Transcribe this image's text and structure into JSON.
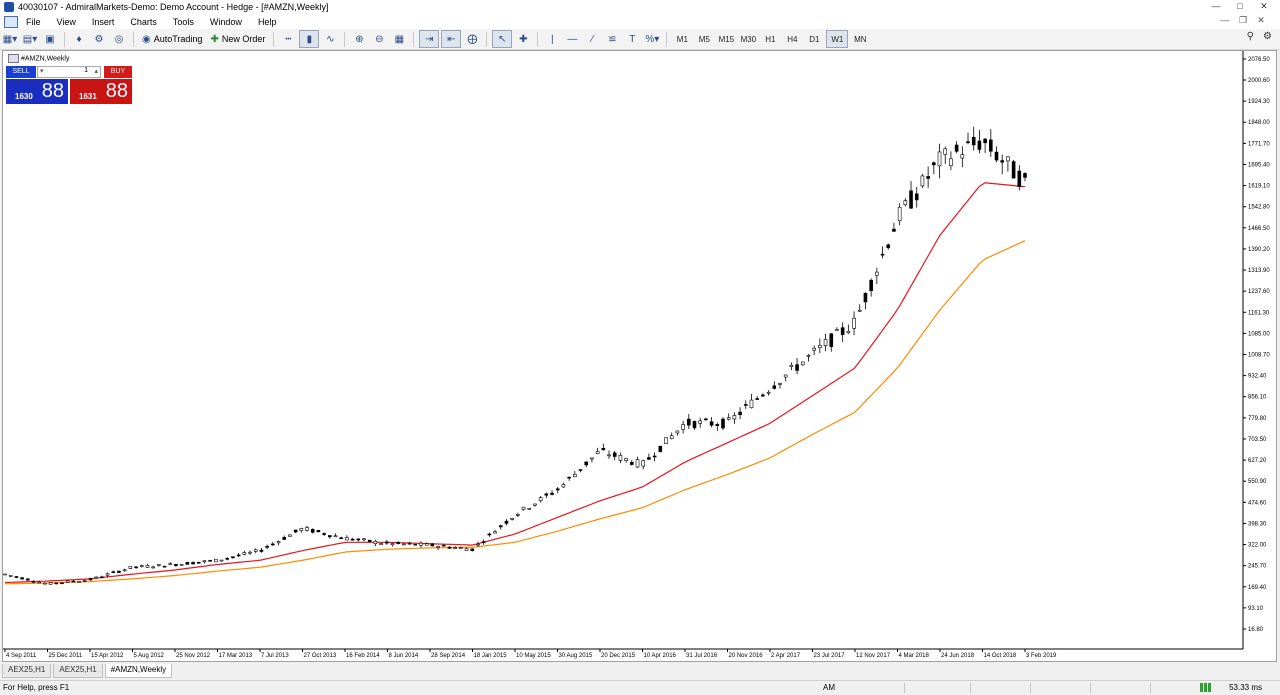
{
  "window": {
    "title": "40030107 - AdmiralMarkets-Demo: Demo Account - Hedge - [#AMZN,Weekly]"
  },
  "menu": [
    "File",
    "View",
    "Insert",
    "Charts",
    "Tools",
    "Window",
    "Help"
  ],
  "toolbar": {
    "autotrading": "AutoTrading",
    "new_order": "New Order",
    "periods": [
      "M1",
      "M5",
      "M15",
      "M30",
      "H1",
      "H4",
      "D1",
      "W1",
      "MN"
    ],
    "active_period": "W1"
  },
  "chart_header": "#AMZN,Weekly",
  "one_click": {
    "sell": "SELL",
    "buy": "BUY",
    "lot": "1",
    "bid_small": "1630",
    "bid_big": "88",
    "ask_small": "1631",
    "ask_big": "88",
    "sell_color": "#1a2fc0",
    "buy_color": "#c91414"
  },
  "chart_data": {
    "type": "candlestick",
    "symbol": "#AMZN",
    "timeframe": "Weekly",
    "x_ticks": [
      "4 Sep 2011",
      "25 Dec 2011",
      "15 Apr 2012",
      "5 Aug 2012",
      "25 Nov 2012",
      "17 Mar 2013",
      "7 Jul 2013",
      "27 Oct 2013",
      "16 Feb 2014",
      "8 Jun 2014",
      "28 Sep 2014",
      "18 Jan 2015",
      "10 May 2015",
      "30 Aug 2015",
      "20 Dec 2015",
      "10 Apr 2016",
      "31 Jul 2016",
      "20 Nov 2016",
      "2 Apr 2017",
      "23 Jul 2017",
      "12 Nov 2017",
      "4 Mar 2018",
      "24 Jun 2018",
      "14 Oct 2018",
      "3 Feb 2019"
    ],
    "y_ticks": [
      "2076.50",
      "2000.60",
      "1924.30",
      "1848.00",
      "1771.70",
      "1695.40",
      "1619.10",
      "1542.80",
      "1466.50",
      "1390.20",
      "1313.90",
      "1237.60",
      "1161.30",
      "1085.00",
      "1008.70",
      "932.40",
      "856.10",
      "779.80",
      "703.50",
      "627.20",
      "550.90",
      "474.60",
      "398.30",
      "322.00",
      "245.70",
      "169.40",
      "93.10",
      "16.80"
    ],
    "ylim": [
      16.8,
      2076.5
    ],
    "series": [
      {
        "name": "candles",
        "points": [
          [
            "4 Sep 2011",
            215
          ],
          [
            "25 Dec 2011",
            180
          ],
          [
            "15 Apr 2012",
            195
          ],
          [
            "5 Aug 2012",
            240
          ],
          [
            "25 Nov 2012",
            250
          ],
          [
            "17 Mar 2013",
            265
          ],
          [
            "7 Jul 2013",
            300
          ],
          [
            "27 Oct 2013",
            380
          ],
          [
            "16 Feb 2014",
            345
          ],
          [
            "8 Jun 2014",
            325
          ],
          [
            "28 Sep 2014",
            320
          ],
          [
            "18 Jan 2015",
            305
          ],
          [
            "10 May 2015",
            430
          ],
          [
            "30 Aug 2015",
            520
          ],
          [
            "20 Dec 2015",
            660
          ],
          [
            "10 Apr 2016",
            610
          ],
          [
            "31 Jul 2016",
            760
          ],
          [
            "20 Nov 2016",
            760
          ],
          [
            "2 Apr 2017",
            890
          ],
          [
            "23 Jul 2017",
            1010
          ],
          [
            "12 Nov 2017",
            1125
          ],
          [
            "4 Mar 2018",
            1500
          ],
          [
            "24 Jun 2018",
            1710
          ],
          [
            "14 Oct 2018",
            1780
          ],
          [
            "3 Feb 2019",
            1630
          ]
        ]
      },
      {
        "name": "red_ma",
        "color": "#e8141c",
        "points": [
          [
            "4 Sep 2011",
            185
          ],
          [
            "25 Dec 2011",
            190
          ],
          [
            "15 Apr 2012",
            198
          ],
          [
            "5 Aug 2012",
            215
          ],
          [
            "25 Nov 2012",
            230
          ],
          [
            "17 Mar 2013",
            250
          ],
          [
            "7 Jul 2013",
            265
          ],
          [
            "27 Oct 2013",
            300
          ],
          [
            "16 Feb 2014",
            330
          ],
          [
            "8 Jun 2014",
            330
          ],
          [
            "28 Sep 2014",
            325
          ],
          [
            "18 Jan 2015",
            320
          ],
          [
            "10 May 2015",
            360
          ],
          [
            "30 Aug 2015",
            420
          ],
          [
            "20 Dec 2015",
            480
          ],
          [
            "10 Apr 2016",
            530
          ],
          [
            "31 Jul 2016",
            620
          ],
          [
            "20 Nov 2016",
            690
          ],
          [
            "2 Apr 2017",
            760
          ],
          [
            "23 Jul 2017",
            860
          ],
          [
            "12 Nov 2017",
            960
          ],
          [
            "4 Mar 2018",
            1170
          ],
          [
            "24 Jun 2018",
            1440
          ],
          [
            "14 Oct 2018",
            1630
          ],
          [
            "3 Feb 2019",
            1615
          ]
        ]
      },
      {
        "name": "orange_ma",
        "color": "#ff8a00",
        "points": [
          [
            "4 Sep 2011",
            180
          ],
          [
            "25 Dec 2011",
            183
          ],
          [
            "15 Apr 2012",
            188
          ],
          [
            "5 Aug 2012",
            198
          ],
          [
            "25 Nov 2012",
            210
          ],
          [
            "17 Mar 2013",
            226
          ],
          [
            "7 Jul 2013",
            240
          ],
          [
            "27 Oct 2013",
            265
          ],
          [
            "16 Feb 2014",
            295
          ],
          [
            "8 Jun 2014",
            305
          ],
          [
            "28 Sep 2014",
            310
          ],
          [
            "18 Jan 2015",
            312
          ],
          [
            "10 May 2015",
            330
          ],
          [
            "30 Aug 2015",
            370
          ],
          [
            "20 Dec 2015",
            415
          ],
          [
            "10 Apr 2016",
            455
          ],
          [
            "31 Jul 2016",
            520
          ],
          [
            "20 Nov 2016",
            575
          ],
          [
            "2 Apr 2017",
            635
          ],
          [
            "23 Jul 2017",
            720
          ],
          [
            "12 Nov 2017",
            800
          ],
          [
            "4 Mar 2018",
            960
          ],
          [
            "24 Jun 2018",
            1170
          ],
          [
            "14 Oct 2018",
            1350
          ],
          [
            "3 Feb 2019",
            1420
          ]
        ]
      }
    ]
  },
  "tabs": [
    "AEX25,H1",
    "AEX25,H1",
    "#AMZN,Weekly"
  ],
  "status": {
    "help": "For Help, press F1",
    "ampm": "AM",
    "ping": "53.33 ms"
  }
}
